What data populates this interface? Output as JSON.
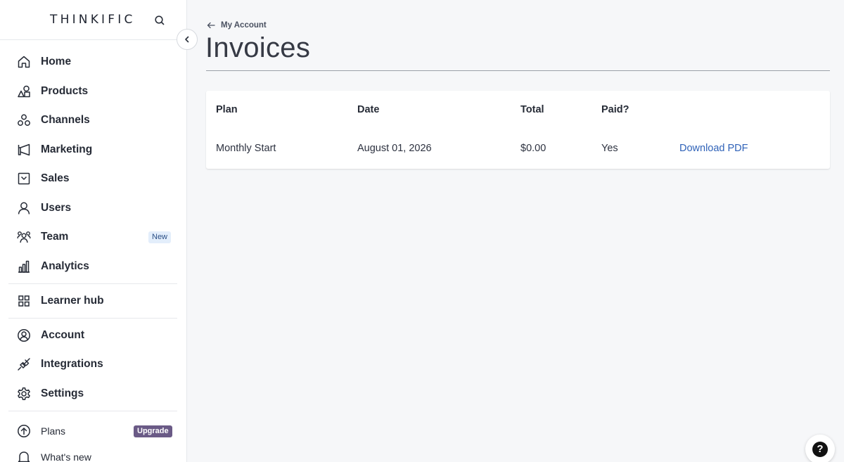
{
  "brand": {
    "logo_text": "THINKIFIC"
  },
  "sidebar": {
    "items": [
      {
        "label": "Home",
        "icon": "home-icon"
      },
      {
        "label": "Products",
        "icon": "products-icon"
      },
      {
        "label": "Channels",
        "icon": "channels-icon"
      },
      {
        "label": "Marketing",
        "icon": "megaphone-icon"
      },
      {
        "label": "Sales",
        "icon": "sales-icon"
      },
      {
        "label": "Users",
        "icon": "user-icon"
      },
      {
        "label": "Team",
        "icon": "team-icon",
        "badge": "New"
      },
      {
        "label": "Analytics",
        "icon": "analytics-icon"
      },
      {
        "label": "Learner hub",
        "icon": "grid-icon"
      },
      {
        "label": "Account",
        "icon": "account-icon"
      },
      {
        "label": "Integrations",
        "icon": "plug-icon"
      },
      {
        "label": "Settings",
        "icon": "gear-icon"
      },
      {
        "label": "Plans",
        "icon": "arrow-up-circle-icon",
        "badge": "Upgrade"
      },
      {
        "label": "What's new",
        "icon": "bell-icon"
      }
    ]
  },
  "main": {
    "back_label": "My Account",
    "title": "Invoices",
    "table": {
      "headers": [
        "Plan",
        "Date",
        "Total",
        "Paid?"
      ],
      "rows": [
        {
          "plan": "Monthly Start",
          "date": "August 01, 2026",
          "total": "$0.00",
          "paid": "Yes",
          "action": "Download PDF"
        }
      ]
    }
  },
  "help": {
    "glyph": "?"
  },
  "colors": {
    "link": "#2f62b8",
    "upgrade_badge": "#6a5a86",
    "new_badge_bg": "#e3eefb"
  }
}
